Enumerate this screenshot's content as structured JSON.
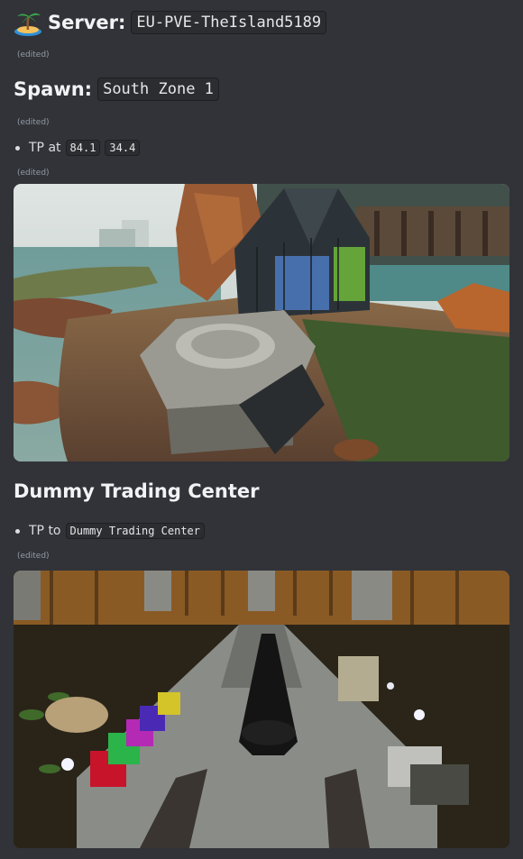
{
  "server": {
    "label": "Server:",
    "name": "EU-PVE-TheIsland5189",
    "edited": "(edited)"
  },
  "spawn": {
    "label": "Spawn:",
    "zone": "South Zone 1",
    "edited": "(edited)",
    "tp_label": "TP at",
    "coord_x": "84.1",
    "coord_y": "34.4",
    "tp_edited": "(edited)"
  },
  "section2": {
    "title": "Dummy Trading Center",
    "tp_label": "TP to",
    "tp_target": "Dummy Trading Center",
    "edited": "(edited)"
  },
  "icons": {
    "server_icon": "desert-island-icon"
  },
  "colors": {
    "background": "#313338",
    "text": "#dbdee1",
    "muted": "#949ba4",
    "code_bg": "#2b2d31"
  }
}
